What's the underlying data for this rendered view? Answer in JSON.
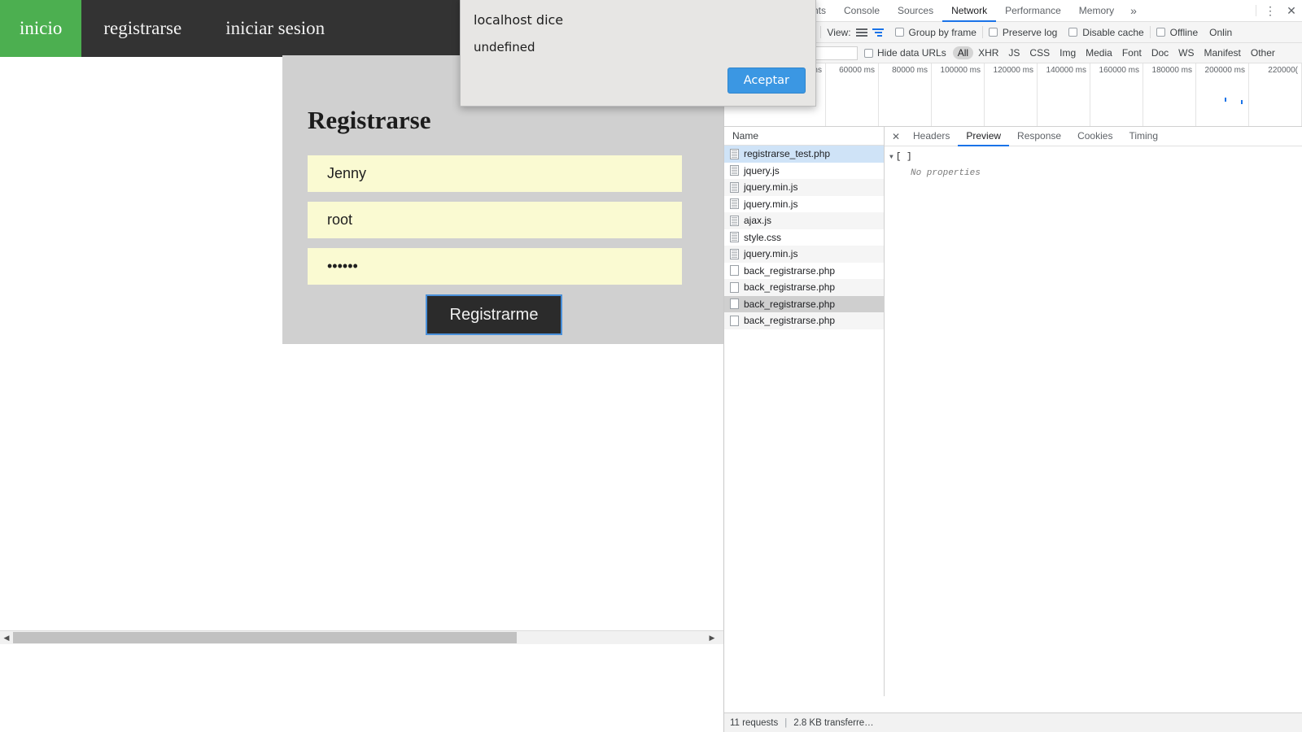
{
  "page": {
    "navbar": {
      "items": [
        {
          "label": "inicio",
          "active": true
        },
        {
          "label": "registrarse",
          "active": false
        },
        {
          "label": "iniciar sesion",
          "active": false
        }
      ]
    },
    "form": {
      "title": "Registrarse",
      "fields": [
        {
          "name": "username",
          "value": "Jenny",
          "placeholder": "",
          "type": "text"
        },
        {
          "name": "email-or-user",
          "value": "root",
          "placeholder": "",
          "type": "text"
        },
        {
          "name": "password",
          "value": "••••••",
          "placeholder": "",
          "type": "password"
        }
      ],
      "submit_label": "Registrarme"
    },
    "colors": {
      "nav_bg": "#333333",
      "nav_active": "#4CAF50",
      "panel_bg": "#d0d0d0",
      "input_autofill": "#fafad2",
      "button_bg": "#2b2b2b",
      "focus_ring": "#4a90d9"
    }
  },
  "dialog": {
    "origin_text": "localhost dice",
    "message": "undefined",
    "accept_label": "Aceptar",
    "accent": "#3b97e3"
  },
  "devtools": {
    "tabs": [
      {
        "label": "nts",
        "active": false
      },
      {
        "label": "Console",
        "active": false
      },
      {
        "label": "Sources",
        "active": false
      },
      {
        "label": "Network",
        "active": true
      },
      {
        "label": "Performance",
        "active": false
      },
      {
        "label": "Memory",
        "active": false
      }
    ],
    "more_tabs_glyph": "»",
    "menu_glyph": "⋮",
    "close_glyph": "✕",
    "toolbar": {
      "search_glyph": "⌕",
      "view_label": "View:",
      "checkboxes": [
        {
          "label": "Group by frame",
          "checked": false
        },
        {
          "label": "Preserve log",
          "checked": false
        },
        {
          "label": "Disable cache",
          "checked": false
        },
        {
          "label": "Offline",
          "checked": false
        }
      ],
      "throttle_value": "Onlin"
    },
    "filterbar": {
      "filter_value": "",
      "filter_placeholder": "",
      "hide_data_urls_label": "Hide data URLs",
      "types": [
        {
          "label": "All",
          "active": true
        },
        {
          "label": "XHR",
          "active": false
        },
        {
          "label": "JS",
          "active": false
        },
        {
          "label": "CSS",
          "active": false
        },
        {
          "label": "Img",
          "active": false
        },
        {
          "label": "Media",
          "active": false
        },
        {
          "label": "Font",
          "active": false
        },
        {
          "label": "Doc",
          "active": false
        },
        {
          "label": "WS",
          "active": false
        },
        {
          "label": "Manifest",
          "active": false
        },
        {
          "label": "Other",
          "active": false
        }
      ]
    },
    "timeline": {
      "ticks": [
        "ms",
        "60000 ms",
        "80000 ms",
        "100000 ms",
        "120000 ms",
        "140000 ms",
        "160000 ms",
        "180000 ms",
        "200000 ms",
        "220000("
      ]
    },
    "requests": {
      "column_header": "Name",
      "rows": [
        {
          "name": "registrarse_test.php",
          "icon": "document-icon",
          "selection": "blue"
        },
        {
          "name": "jquery.js",
          "icon": "document-icon",
          "selection": "none"
        },
        {
          "name": "jquery.min.js",
          "icon": "document-icon",
          "selection": "none"
        },
        {
          "name": "jquery.min.js",
          "icon": "document-icon",
          "selection": "none"
        },
        {
          "name": "ajax.js",
          "icon": "document-icon",
          "selection": "none"
        },
        {
          "name": "style.css",
          "icon": "document-icon",
          "selection": "none"
        },
        {
          "name": "jquery.min.js",
          "icon": "document-icon",
          "selection": "none"
        },
        {
          "name": "back_registrarse.php",
          "icon": "blank-file-icon",
          "selection": "none"
        },
        {
          "name": "back_registrarse.php",
          "icon": "blank-file-icon",
          "selection": "none"
        },
        {
          "name": "back_registrarse.php",
          "icon": "blank-file-icon",
          "selection": "gray"
        },
        {
          "name": "back_registrarse.php",
          "icon": "blank-file-icon",
          "selection": "none"
        }
      ]
    },
    "detail": {
      "close_glyph": "✕",
      "tabs": [
        {
          "label": "Headers",
          "active": false
        },
        {
          "label": "Preview",
          "active": true
        },
        {
          "label": "Response",
          "active": false
        },
        {
          "label": "Cookies",
          "active": false
        },
        {
          "label": "Timing",
          "active": false
        }
      ],
      "preview": {
        "root_node": "[ ]",
        "empty_text": "No properties",
        "disclosure_glyph": "▼"
      }
    },
    "statusbar": {
      "requests_text": "11 requests",
      "separator": "|",
      "transferred_text": "2.8 KB transferre…"
    }
  },
  "scrollbar": {
    "left_glyph": "◀",
    "right_glyph": "▶"
  }
}
